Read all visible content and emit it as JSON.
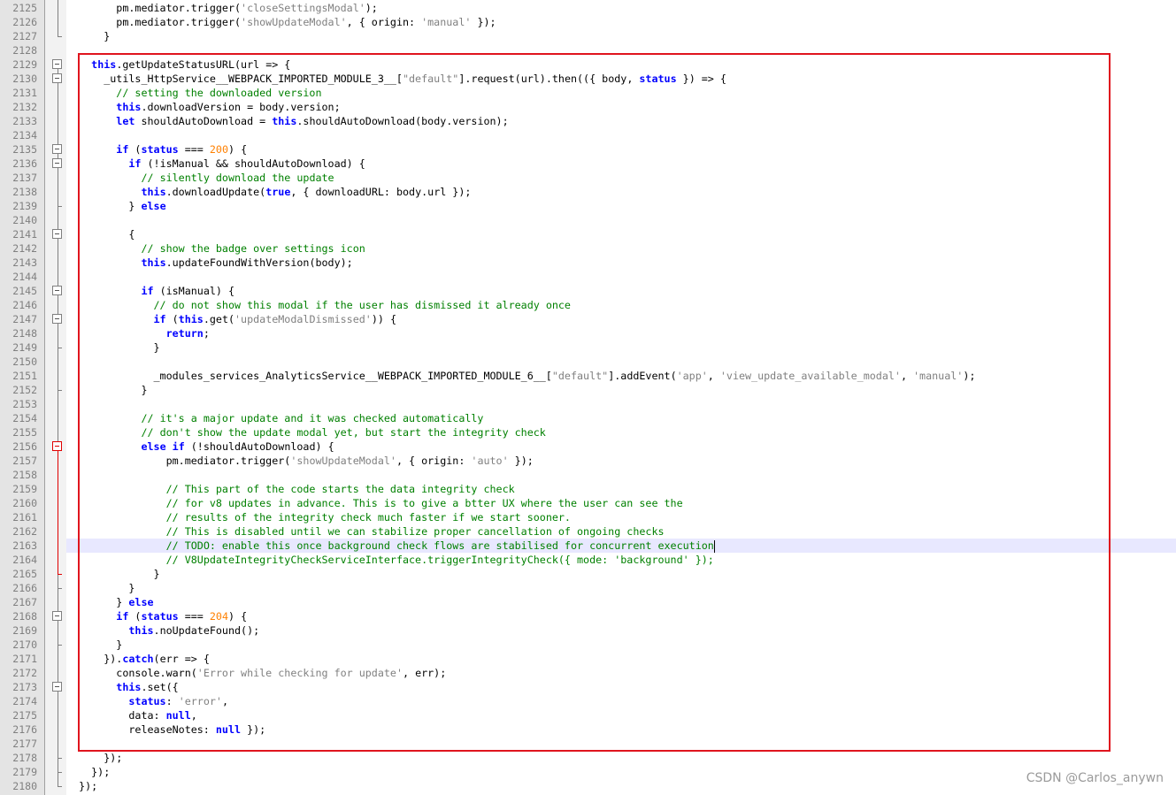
{
  "editor": {
    "lines": [
      {
        "num": "2125",
        "tokens": [
          [
            "t",
            "        pm.mediator.trigger("
          ],
          [
            "s",
            "'closeSettingsModal'"
          ],
          [
            "t",
            ");"
          ]
        ]
      },
      {
        "num": "2126",
        "tokens": [
          [
            "t",
            "        pm.mediator.trigger("
          ],
          [
            "s",
            "'showUpdateModal'"
          ],
          [
            "t",
            ", { origin: "
          ],
          [
            "s",
            "'manual'"
          ],
          [
            "t",
            " });"
          ]
        ]
      },
      {
        "num": "2127",
        "tokens": [
          [
            "t",
            "      }"
          ]
        ]
      },
      {
        "num": "2128",
        "tokens": []
      },
      {
        "num": "2129",
        "tokens": [
          [
            "t",
            "    "
          ],
          [
            "k",
            "this"
          ],
          [
            "t",
            ".getUpdateStatusURL(url => {"
          ]
        ]
      },
      {
        "num": "2130",
        "tokens": [
          [
            "t",
            "      _utils_HttpService__WEBPACK_IMPORTED_MODULE_3__["
          ],
          [
            "s",
            "\"default\""
          ],
          [
            "t",
            "].request(url).then(({ body, "
          ],
          [
            "k",
            "status"
          ],
          [
            "t",
            " }) => {"
          ]
        ]
      },
      {
        "num": "2131",
        "tokens": [
          [
            "t",
            "        "
          ],
          [
            "c",
            "// setting the downloaded version"
          ]
        ]
      },
      {
        "num": "2132",
        "tokens": [
          [
            "t",
            "        "
          ],
          [
            "k",
            "this"
          ],
          [
            "t",
            ".downloadVersion = body.version;"
          ]
        ]
      },
      {
        "num": "2133",
        "tokens": [
          [
            "t",
            "        "
          ],
          [
            "k",
            "let"
          ],
          [
            "t",
            " shouldAutoDownload = "
          ],
          [
            "k",
            "this"
          ],
          [
            "t",
            ".shouldAutoDownload(body.version);"
          ]
        ]
      },
      {
        "num": "2134",
        "tokens": []
      },
      {
        "num": "2135",
        "tokens": [
          [
            "t",
            "        "
          ],
          [
            "k",
            "if"
          ],
          [
            "t",
            " ("
          ],
          [
            "k",
            "status"
          ],
          [
            "t",
            " === "
          ],
          [
            "n",
            "200"
          ],
          [
            "t",
            ") {"
          ]
        ]
      },
      {
        "num": "2136",
        "tokens": [
          [
            "t",
            "          "
          ],
          [
            "k",
            "if"
          ],
          [
            "t",
            " (!isManual && shouldAutoDownload) {"
          ]
        ]
      },
      {
        "num": "2137",
        "tokens": [
          [
            "t",
            "            "
          ],
          [
            "c",
            "// silently download the update"
          ]
        ]
      },
      {
        "num": "2138",
        "tokens": [
          [
            "t",
            "            "
          ],
          [
            "k",
            "this"
          ],
          [
            "t",
            ".downloadUpdate("
          ],
          [
            "k",
            "true"
          ],
          [
            "t",
            ", { downloadURL: body.url });"
          ]
        ]
      },
      {
        "num": "2139",
        "tokens": [
          [
            "t",
            "          } "
          ],
          [
            "k",
            "else"
          ]
        ]
      },
      {
        "num": "2140",
        "tokens": []
      },
      {
        "num": "2141",
        "tokens": [
          [
            "t",
            "          {"
          ]
        ]
      },
      {
        "num": "2142",
        "tokens": [
          [
            "t",
            "            "
          ],
          [
            "c",
            "// show the badge over settings icon"
          ]
        ]
      },
      {
        "num": "2143",
        "tokens": [
          [
            "t",
            "            "
          ],
          [
            "k",
            "this"
          ],
          [
            "t",
            ".updateFoundWithVersion(body);"
          ]
        ]
      },
      {
        "num": "2144",
        "tokens": []
      },
      {
        "num": "2145",
        "tokens": [
          [
            "t",
            "            "
          ],
          [
            "k",
            "if"
          ],
          [
            "t",
            " (isManual) {"
          ]
        ]
      },
      {
        "num": "2146",
        "tokens": [
          [
            "t",
            "              "
          ],
          [
            "c",
            "// do not show this modal if the user has dismissed it already once"
          ]
        ]
      },
      {
        "num": "2147",
        "tokens": [
          [
            "t",
            "              "
          ],
          [
            "k",
            "if"
          ],
          [
            "t",
            " ("
          ],
          [
            "k",
            "this"
          ],
          [
            "t",
            ".get("
          ],
          [
            "s",
            "'updateModalDismissed'"
          ],
          [
            "t",
            ")) {"
          ]
        ]
      },
      {
        "num": "2148",
        "tokens": [
          [
            "t",
            "                "
          ],
          [
            "k",
            "return"
          ],
          [
            "t",
            ";"
          ]
        ]
      },
      {
        "num": "2149",
        "tokens": [
          [
            "t",
            "              }"
          ]
        ]
      },
      {
        "num": "2150",
        "tokens": []
      },
      {
        "num": "2151",
        "tokens": [
          [
            "t",
            "              _modules_services_AnalyticsService__WEBPACK_IMPORTED_MODULE_6__["
          ],
          [
            "s",
            "\"default\""
          ],
          [
            "t",
            "].addEvent("
          ],
          [
            "s",
            "'app'"
          ],
          [
            "t",
            ", "
          ],
          [
            "s",
            "'view_update_available_modal'"
          ],
          [
            "t",
            ", "
          ],
          [
            "s",
            "'manual'"
          ],
          [
            "t",
            ");"
          ]
        ]
      },
      {
        "num": "2152",
        "tokens": [
          [
            "t",
            "            }"
          ]
        ]
      },
      {
        "num": "2153",
        "tokens": []
      },
      {
        "num": "2154",
        "tokens": [
          [
            "t",
            "            "
          ],
          [
            "c",
            "// it's a major update and it was checked automatically"
          ]
        ]
      },
      {
        "num": "2155",
        "tokens": [
          [
            "t",
            "            "
          ],
          [
            "c",
            "// don't show the update modal yet, but start the integrity check"
          ]
        ]
      },
      {
        "num": "2156",
        "tokens": [
          [
            "t",
            "            "
          ],
          [
            "k",
            "else"
          ],
          [
            "t",
            " "
          ],
          [
            "k",
            "if"
          ],
          [
            "t",
            " (!shouldAutoDownload) {"
          ]
        ]
      },
      {
        "num": "2157",
        "tokens": [
          [
            "t",
            "                pm.mediator.trigger("
          ],
          [
            "s",
            "'showUpdateModal'"
          ],
          [
            "t",
            ", { origin: "
          ],
          [
            "s",
            "'auto'"
          ],
          [
            "t",
            " });"
          ]
        ]
      },
      {
        "num": "2158",
        "tokens": []
      },
      {
        "num": "2159",
        "tokens": [
          [
            "t",
            "                "
          ],
          [
            "c",
            "// This part of the code starts the data integrity check"
          ]
        ]
      },
      {
        "num": "2160",
        "tokens": [
          [
            "t",
            "                "
          ],
          [
            "c",
            "// for v8 updates in advance. This is to give a btter UX where the user can see the"
          ]
        ]
      },
      {
        "num": "2161",
        "tokens": [
          [
            "t",
            "                "
          ],
          [
            "c",
            "// results of the integrity check much faster if we start sooner."
          ]
        ]
      },
      {
        "num": "2162",
        "tokens": [
          [
            "t",
            "                "
          ],
          [
            "c",
            "// This is disabled until we can stabilize proper cancellation of ongoing checks"
          ]
        ]
      },
      {
        "num": "2163",
        "current": true,
        "tokens": [
          [
            "t",
            "                "
          ],
          [
            "c",
            "// TODO: enable this once background check flows are stabilised for concurrent execution"
          ]
        ]
      },
      {
        "num": "2164",
        "tokens": [
          [
            "t",
            "                "
          ],
          [
            "c",
            "// V8UpdateIntegrityCheckServiceInterface.triggerIntegrityCheck({ mode: 'background' });"
          ]
        ]
      },
      {
        "num": "2165",
        "tokens": [
          [
            "t",
            "              }"
          ]
        ]
      },
      {
        "num": "2166",
        "tokens": [
          [
            "t",
            "          }"
          ]
        ]
      },
      {
        "num": "2167",
        "tokens": [
          [
            "t",
            "        } "
          ],
          [
            "k",
            "else"
          ]
        ]
      },
      {
        "num": "2168",
        "tokens": [
          [
            "t",
            "        "
          ],
          [
            "k",
            "if"
          ],
          [
            "t",
            " ("
          ],
          [
            "k",
            "status"
          ],
          [
            "t",
            " === "
          ],
          [
            "n",
            "204"
          ],
          [
            "t",
            ") {"
          ]
        ]
      },
      {
        "num": "2169",
        "tokens": [
          [
            "t",
            "          "
          ],
          [
            "k",
            "this"
          ],
          [
            "t",
            ".noUpdateFound();"
          ]
        ]
      },
      {
        "num": "2170",
        "tokens": [
          [
            "t",
            "        }"
          ]
        ]
      },
      {
        "num": "2171",
        "tokens": [
          [
            "t",
            "      })."
          ],
          [
            "k",
            "catch"
          ],
          [
            "t",
            "(err => {"
          ]
        ]
      },
      {
        "num": "2172",
        "tokens": [
          [
            "t",
            "        console.warn("
          ],
          [
            "s",
            "'Error while checking for update'"
          ],
          [
            "t",
            ", err);"
          ]
        ]
      },
      {
        "num": "2173",
        "tokens": [
          [
            "t",
            "        "
          ],
          [
            "k",
            "this"
          ],
          [
            "t",
            ".set({"
          ]
        ]
      },
      {
        "num": "2174",
        "tokens": [
          [
            "t",
            "          "
          ],
          [
            "k",
            "status"
          ],
          [
            "t",
            ": "
          ],
          [
            "s",
            "'error'"
          ],
          [
            "t",
            ","
          ]
        ]
      },
      {
        "num": "2175",
        "tokens": [
          [
            "t",
            "          data: "
          ],
          [
            "k",
            "null"
          ],
          [
            "t",
            ","
          ]
        ]
      },
      {
        "num": "2176",
        "tokens": [
          [
            "t",
            "          releaseNotes: "
          ],
          [
            "k",
            "null"
          ],
          [
            "t",
            " });"
          ]
        ]
      },
      {
        "num": "2177",
        "tokens": []
      },
      {
        "num": "2178",
        "tokens": [
          [
            "t",
            "      });"
          ]
        ]
      },
      {
        "num": "2179",
        "tokens": [
          [
            "t",
            "    });"
          ]
        ]
      },
      {
        "num": "2180",
        "tokens": [
          [
            "t",
            "  });"
          ]
        ]
      }
    ]
  },
  "colors": {
    "keyword": "#0000ff",
    "string": "#808080",
    "number": "#ff8000",
    "comment": "#008000",
    "highlight_box": "#e0141e"
  },
  "watermark": "CSDN @Carlos_anywn"
}
